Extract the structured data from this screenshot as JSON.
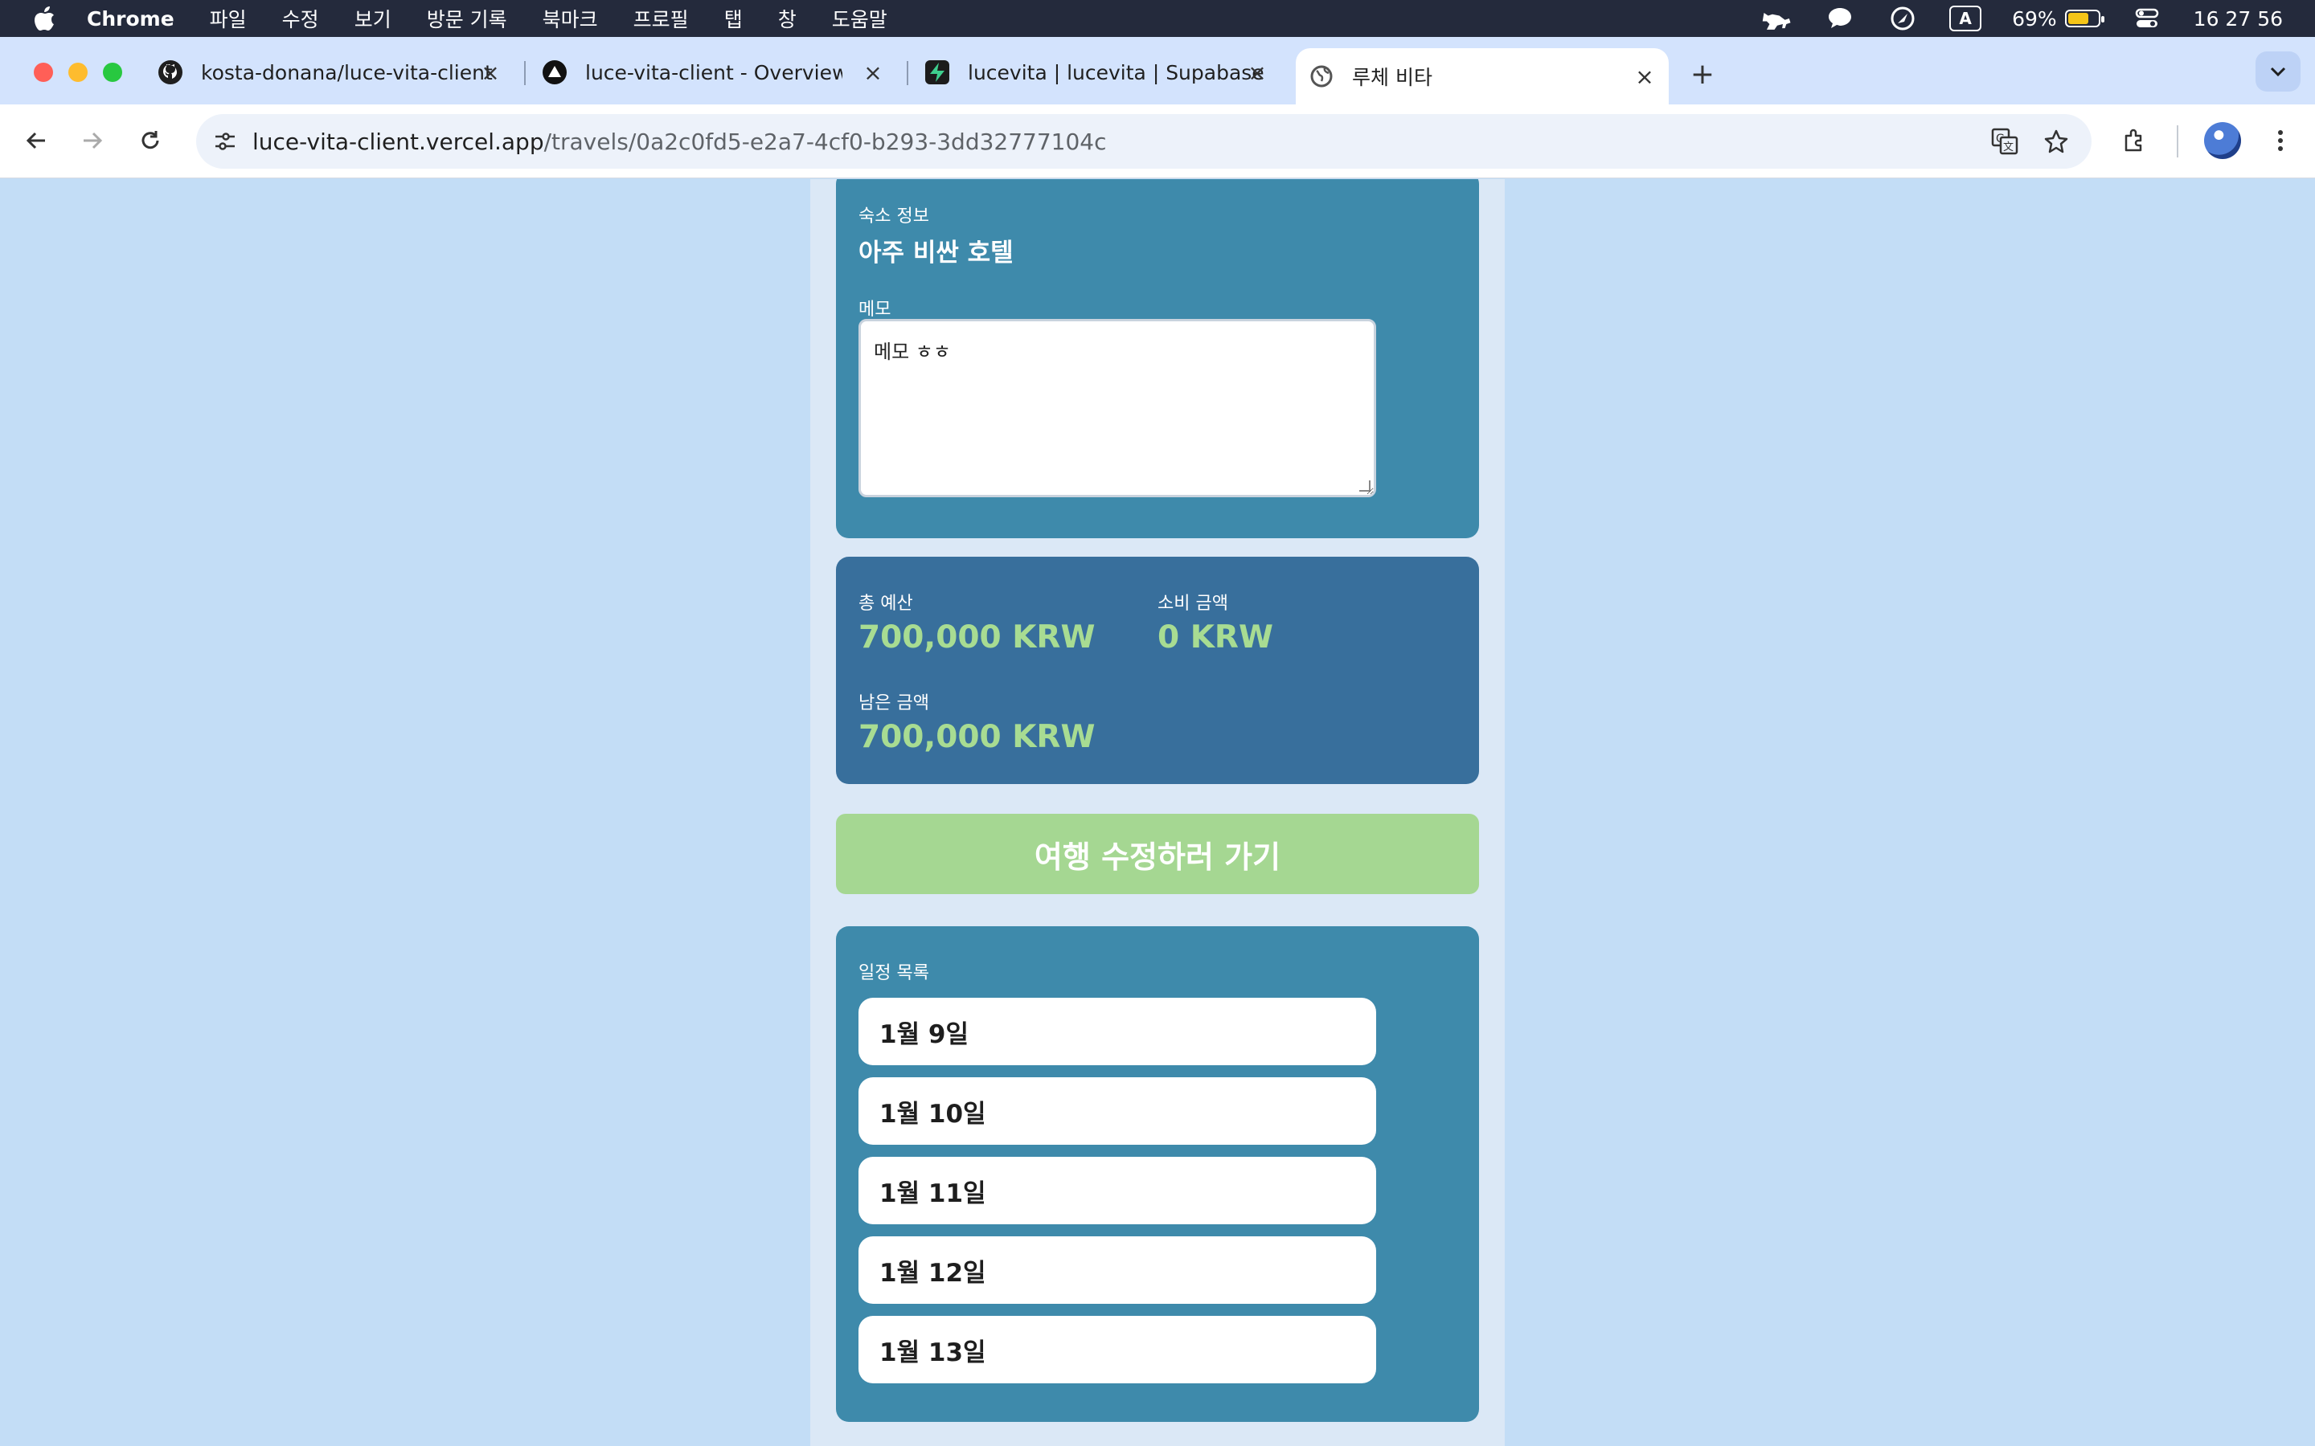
{
  "menubar": {
    "app_name": "Chrome",
    "menus": [
      "파일",
      "수정",
      "보기",
      "방문 기록",
      "북마크",
      "프로필",
      "탭",
      "창",
      "도움말"
    ],
    "battery_percent": "69%",
    "battery_level": 0.69,
    "clock": "16 27 56",
    "input_source": "A"
  },
  "tabs": [
    {
      "title": "kosta-donana/luce-vita-client",
      "icon": "github-icon"
    },
    {
      "title": "luce-vita-client - Overview –",
      "icon": "vercel-icon"
    },
    {
      "title": "lucevita | lucevita | Supabase",
      "icon": "supabase-icon"
    },
    {
      "title": "루체 비타",
      "icon": "globe-icon",
      "active": true
    }
  ],
  "toolbar": {
    "url_host": "luce-vita-client.vercel.app",
    "url_path": "/travels/0a2c0fd5-e2a7-4cf0-b293-3dd32777104c"
  },
  "page": {
    "lodging": {
      "label": "숙소 정보",
      "value": "아주 비싼 호텔"
    },
    "memo": {
      "label": "메모",
      "value": "메모 ㅎㅎ"
    },
    "budget": {
      "total_label": "총 예산",
      "total_value": "700,000 KRW",
      "spent_label": "소비 금액",
      "spent_value": "0 KRW",
      "remaining_label": "남은 금액",
      "remaining_value": "700,000 KRW"
    },
    "edit_button": "여행 수정하러 가기",
    "schedule": {
      "label": "일정 목록",
      "days": [
        "1월 9일",
        "1월 10일",
        "1월 11일",
        "1월 12일",
        "1월 13일"
      ]
    }
  },
  "colors": {
    "page_bg": "#c3ddf6",
    "card_teal": "#3e8aab",
    "card_blue": "#386f9c",
    "money_green": "#a8dc92",
    "button_green": "#a5d792"
  }
}
